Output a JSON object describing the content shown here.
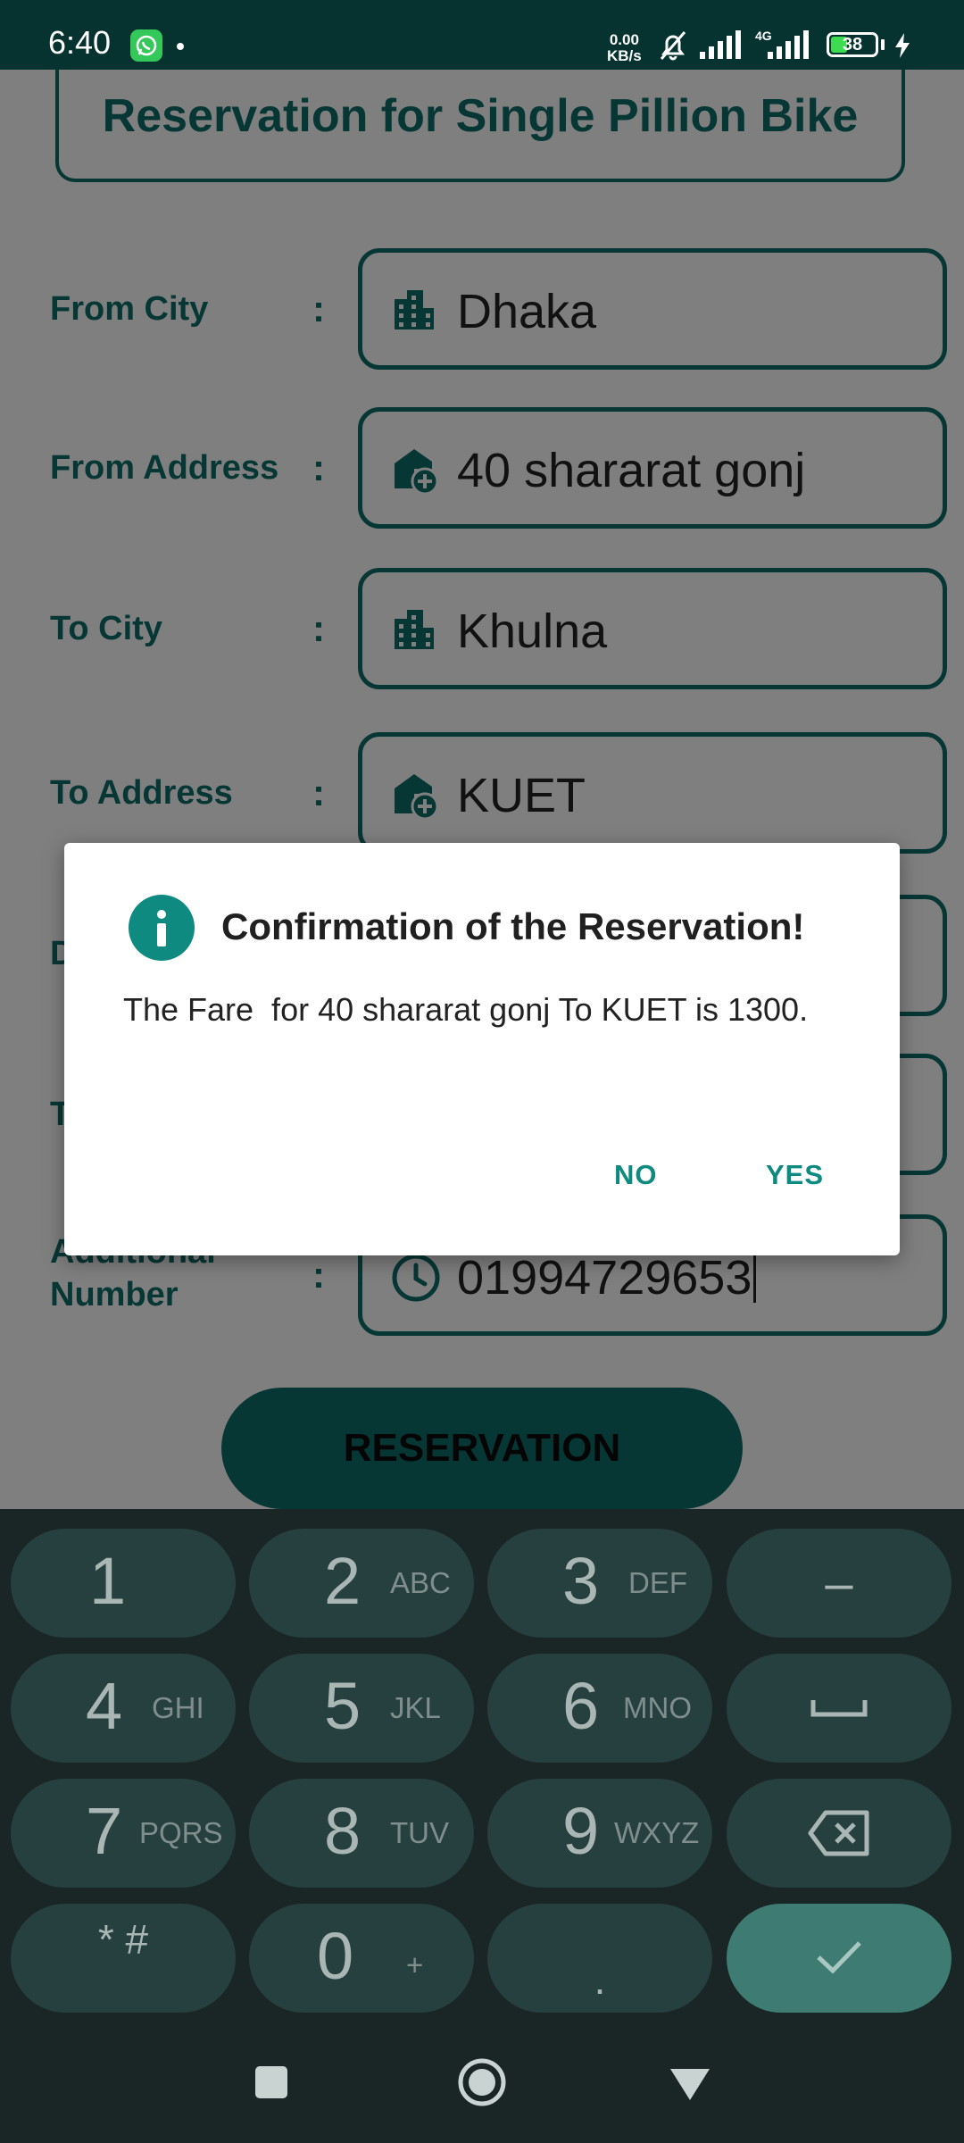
{
  "status_bar": {
    "time": "6:40",
    "net_speed_value": "0.00",
    "net_speed_unit": "KB/s",
    "network_type": "4G",
    "battery": "38",
    "battery_level": 0.38,
    "icons": [
      "whatsapp-icon",
      "notification-dot",
      "bell-muted-icon",
      "signal-icon",
      "signal-4g-icon",
      "battery-icon",
      "charging-bolt-icon"
    ]
  },
  "page": {
    "title": "Reservation for Single Pillion Bike"
  },
  "form": {
    "colon": ":",
    "rows": [
      {
        "label": "From City",
        "value": "Dhaka",
        "icon": "city-icon"
      },
      {
        "label": "From Address",
        "value": "40 shararat gonj",
        "icon": "add-home-icon"
      },
      {
        "label": "To City",
        "value": "Khulna",
        "icon": "city-icon"
      },
      {
        "label": "To Address",
        "value": "KUET",
        "icon": "add-home-icon"
      },
      {
        "label": "D",
        "value": "",
        "icon": ""
      },
      {
        "label": "T",
        "value": "",
        "icon": ""
      },
      {
        "label_line1": "Additional",
        "label_line2": "Number",
        "value": "01994729653",
        "icon": "clock-icon"
      }
    ],
    "submit_label": "RESERVATION"
  },
  "dialog": {
    "icon": "info-icon",
    "title": "Confirmation of the Reservation!",
    "message": "The Fare  for 40 shararat gonj To KUET is 1300.",
    "no_label": "NO",
    "yes_label": "YES"
  },
  "keyboard": {
    "keys": [
      {
        "num": "1",
        "letters": ""
      },
      {
        "num": "2",
        "letters": "ABC"
      },
      {
        "num": "3",
        "letters": "DEF"
      },
      {
        "num": "4",
        "letters": "GHI"
      },
      {
        "num": "5",
        "letters": "JKL"
      },
      {
        "num": "6",
        "letters": "MNO"
      },
      {
        "num": "7",
        "letters": "PQRS"
      },
      {
        "num": "8",
        "letters": "TUV"
      },
      {
        "num": "9",
        "letters": "WXYZ"
      },
      {
        "num": "0",
        "letters": "+"
      }
    ],
    "star_hash": "* #",
    "minus": "–",
    "dot": ".",
    "colors": {
      "background": "#1a2625",
      "key": "#26403f",
      "enter": "#3e7c73"
    }
  },
  "nav_bar": {
    "icons": [
      "recents-square-icon",
      "home-circle-icon",
      "back-triangle-icon"
    ]
  },
  "colors": {
    "accent": "#0e6f6a",
    "dialog_accent": "#0e8a80",
    "status_bar": "#063330"
  }
}
